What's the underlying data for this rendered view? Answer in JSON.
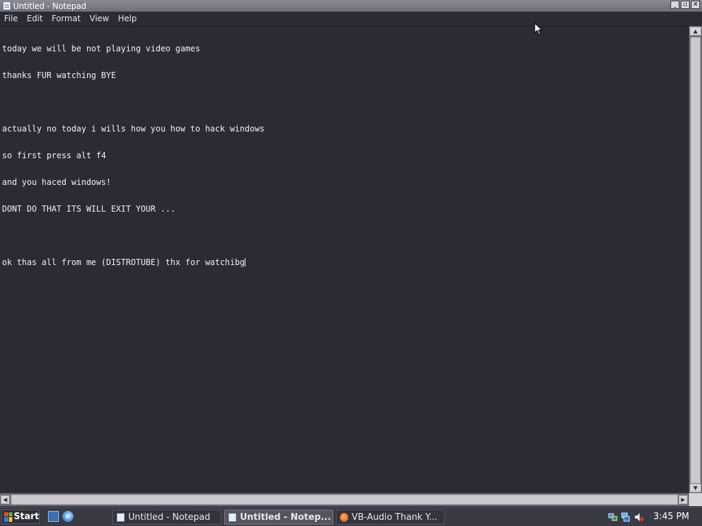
{
  "window": {
    "title": "Untitled - Notepad",
    "controls": {
      "minimize": "_",
      "maximize": "▫",
      "close": "✕"
    }
  },
  "menu": [
    "File",
    "Edit",
    "Format",
    "View",
    "Help"
  ],
  "document": {
    "lines": [
      "today we will be not playing video games",
      "thanks FUR watching BYE",
      "",
      "actually no today i wills how you how to hack windows",
      "so first press alt f4",
      "and you haced windows!",
      "DONT DO THAT ITS WILL EXIT YOUR ...",
      "",
      "ok thas all from me (DISTROTUBE) thx for watchibg"
    ]
  },
  "taskbar": {
    "start_label": "Start",
    "quick_launch": [
      "show-desktop-icon",
      "internet-explorer-icon"
    ],
    "tasks": [
      {
        "label": "Untitled - Notepad",
        "icon": "notepad-icon",
        "active": false
      },
      {
        "label": "Untitled - Notep...",
        "icon": "notepad-icon",
        "active": true
      },
      {
        "label": "VB-Audio Thank Y...",
        "icon": "firefox-icon",
        "active": false
      }
    ],
    "clock": "3:45 PM"
  },
  "colors": {
    "background": "#2b2b35",
    "text": "#f2f2f2",
    "titlebar": "#7a7a84",
    "taskbar": "#3a3a44"
  }
}
